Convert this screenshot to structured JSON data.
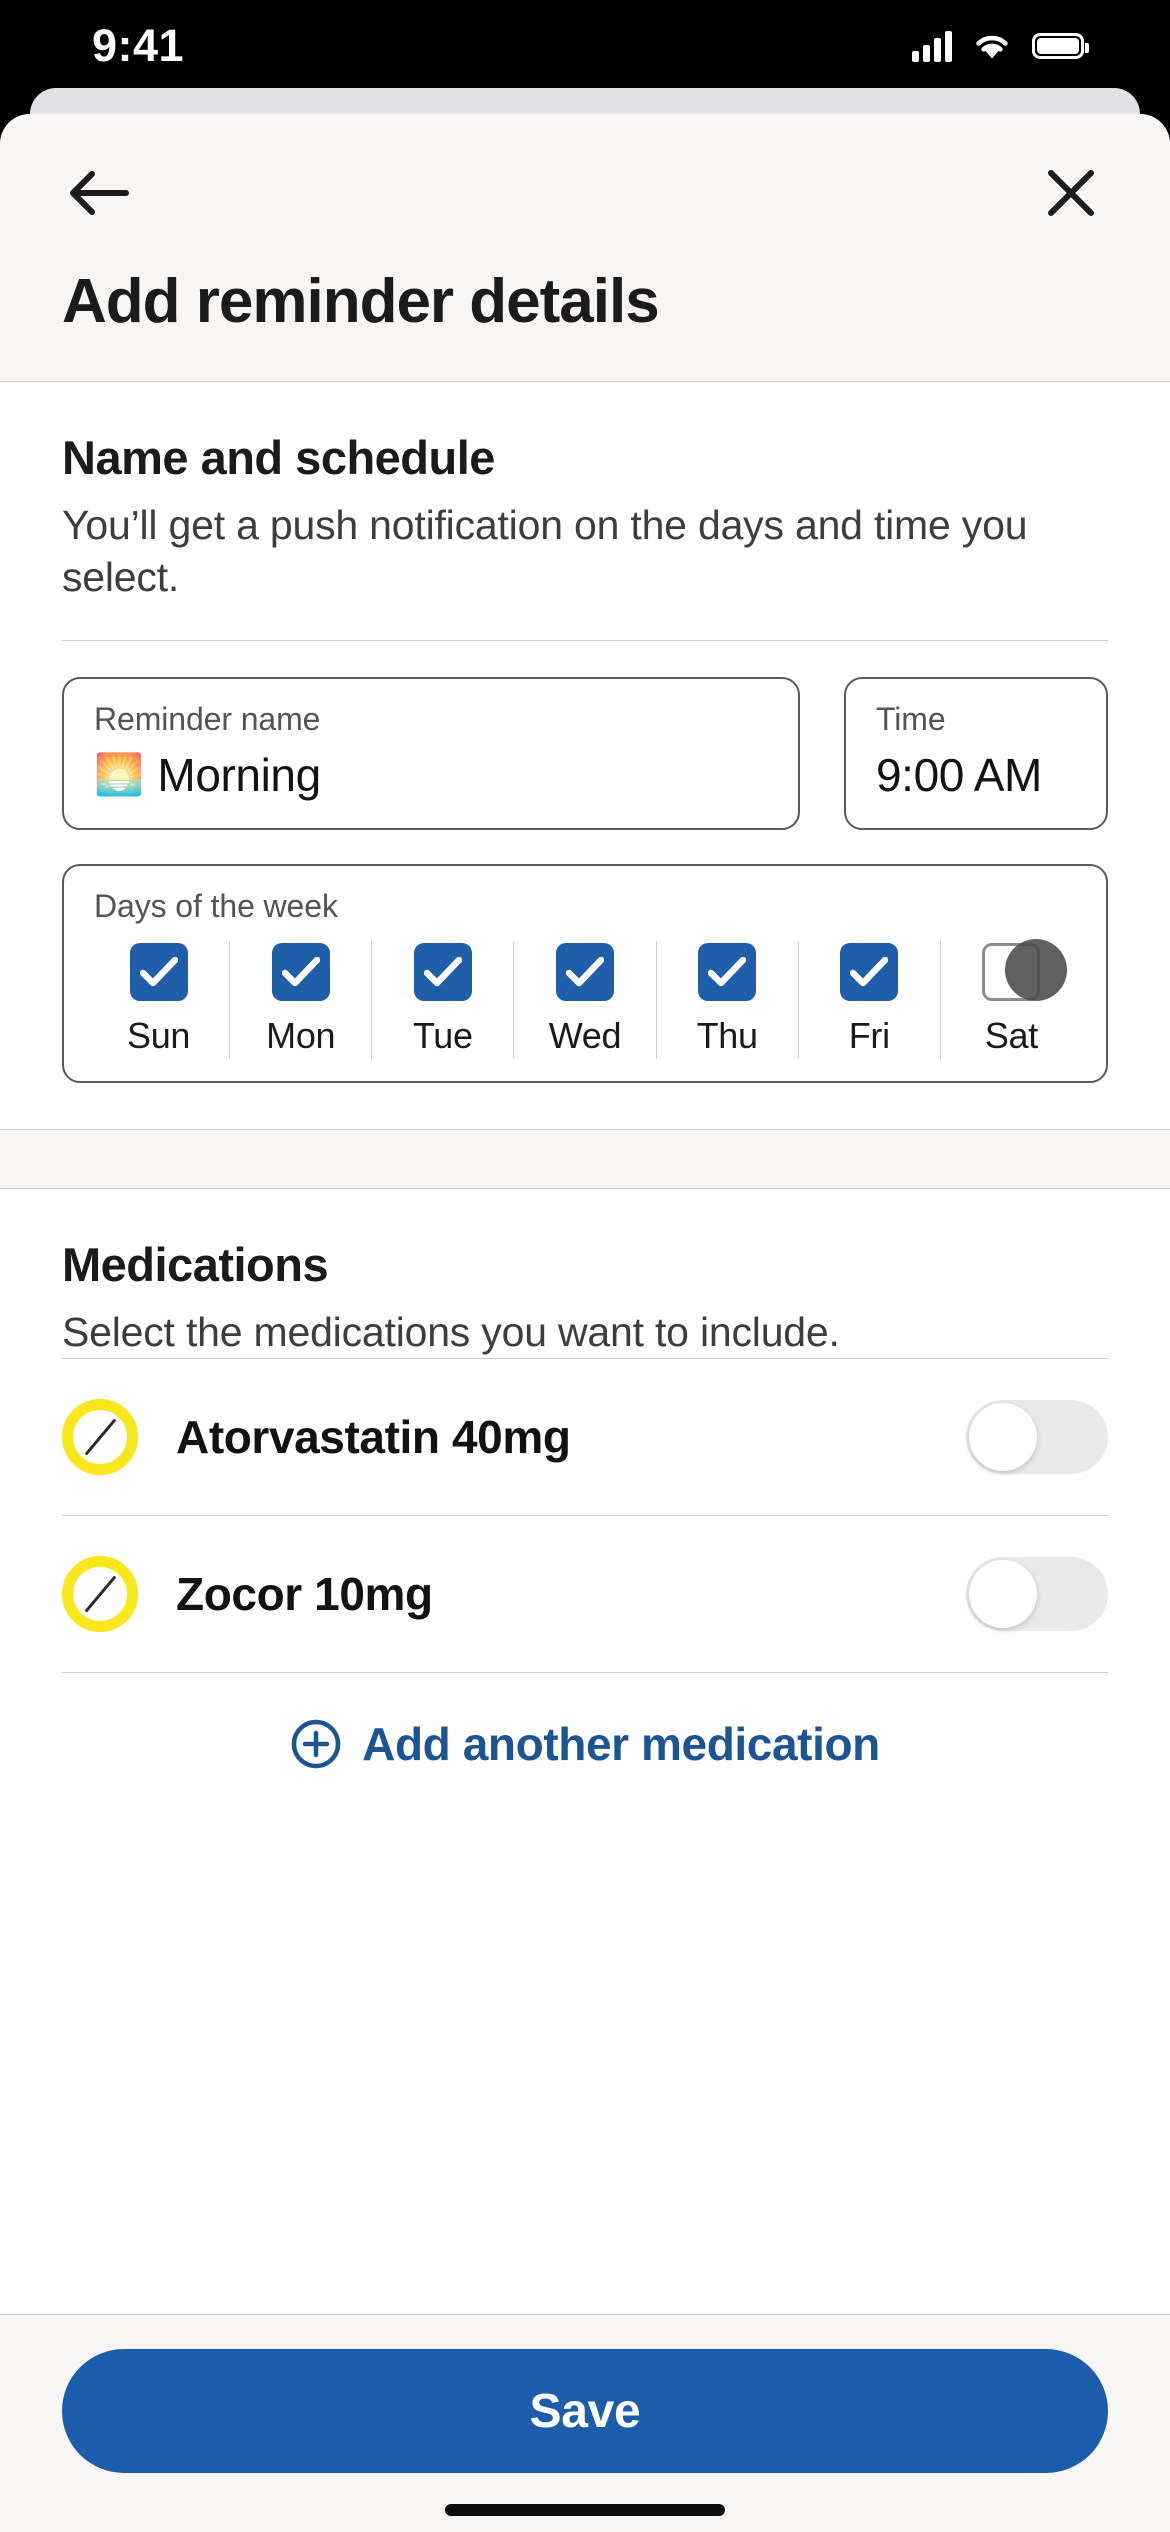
{
  "status_bar": {
    "time": "9:41",
    "signal_icon": "cellular-signal-icon",
    "wifi_icon": "wifi-icon",
    "battery_icon": "battery-icon"
  },
  "header": {
    "back_icon": "back-arrow-icon",
    "close_icon": "close-x-icon",
    "title": "Add reminder details"
  },
  "schedule_section": {
    "title": "Name and schedule",
    "description": "You’ll get a push notification on the days and time you select.",
    "reminder_name_field": {
      "label": "Reminder name",
      "emoji": "🌅",
      "value": "Morning"
    },
    "time_field": {
      "label": "Time",
      "value": "9:00 AM"
    },
    "days_field": {
      "label": "Days of the week",
      "days": [
        {
          "label": "Sun",
          "checked": true
        },
        {
          "label": "Mon",
          "checked": true
        },
        {
          "label": "Tue",
          "checked": true
        },
        {
          "label": "Wed",
          "checked": true
        },
        {
          "label": "Thu",
          "checked": true
        },
        {
          "label": "Fri",
          "checked": true
        },
        {
          "label": "Sat",
          "checked": false
        }
      ]
    }
  },
  "medications_section": {
    "title": "Medications",
    "description": "Select the medications you want to include.",
    "items": [
      {
        "icon": "pill-icon",
        "name": "Atorvastatin 40mg",
        "toggle_on": false
      },
      {
        "icon": "pill-icon",
        "name": "Zocor 10mg",
        "toggle_on": false
      }
    ],
    "add_link": {
      "icon": "plus-circle-icon",
      "label": "Add another medication"
    }
  },
  "footer": {
    "save_label": "Save"
  },
  "colors": {
    "accent_blue": "#1b5daa",
    "link_blue": "#1d5594",
    "pill_yellow": "#f8e71c",
    "header_bg": "#f7f6f4"
  }
}
